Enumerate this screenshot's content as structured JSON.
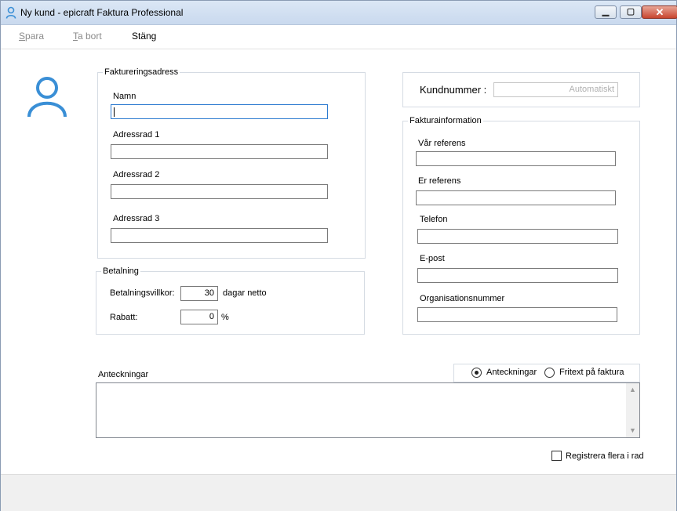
{
  "window": {
    "title": "Ny kund - epicraft Faktura Professional",
    "minimize_symbol": "▁",
    "maximize_symbol": "▢",
    "close_symbol": "✕"
  },
  "toolbar": {
    "save_label": "Spara",
    "delete_label": "Ta bort",
    "close_label": "Stäng"
  },
  "billing_address": {
    "legend": "Faktureringsadress",
    "name_label": "Namn",
    "name_value": "",
    "address1_label": "Adressrad 1",
    "address1_value": "",
    "address2_label": "Adressrad 2",
    "address2_value": "",
    "address3_label": "Adressrad 3",
    "address3_value": ""
  },
  "payment": {
    "legend": "Betalning",
    "terms_label": "Betalningsvillkor:",
    "terms_value": "30",
    "terms_suffix": "dagar netto",
    "discount_label": "Rabatt:",
    "discount_value": "0",
    "discount_suffix": "%"
  },
  "customer_number": {
    "label": "Kundnummer :",
    "placeholder": "Automatiskt"
  },
  "invoice_info": {
    "legend": "Fakturainformation",
    "our_reference_label": "Vår referens",
    "our_reference_value": "",
    "your_reference_label": "Er referens",
    "your_reference_value": "",
    "phone_label": "Telefon",
    "phone_value": "",
    "email_label": "E-post",
    "email_value": "",
    "org_number_label": "Organisationsnummer",
    "org_number_value": ""
  },
  "notes": {
    "label": "Anteckningar",
    "radio_notes_label": "Anteckningar",
    "radio_freetext_label": "Fritext på faktura",
    "selected": "Anteckningar",
    "value": ""
  },
  "register_multiple": {
    "label": "Registrera flera i rad",
    "checked": false
  },
  "icons": {
    "app": "user-icon",
    "avatar": "user-avatar-icon",
    "scroll_up": "▲",
    "scroll_down": "▼"
  },
  "colors": {
    "accent": "#3a8fd6",
    "focus_border": "#2d7bd0",
    "titlebar": "#d2e0f2",
    "disabled_text": "#8a8a8a"
  }
}
